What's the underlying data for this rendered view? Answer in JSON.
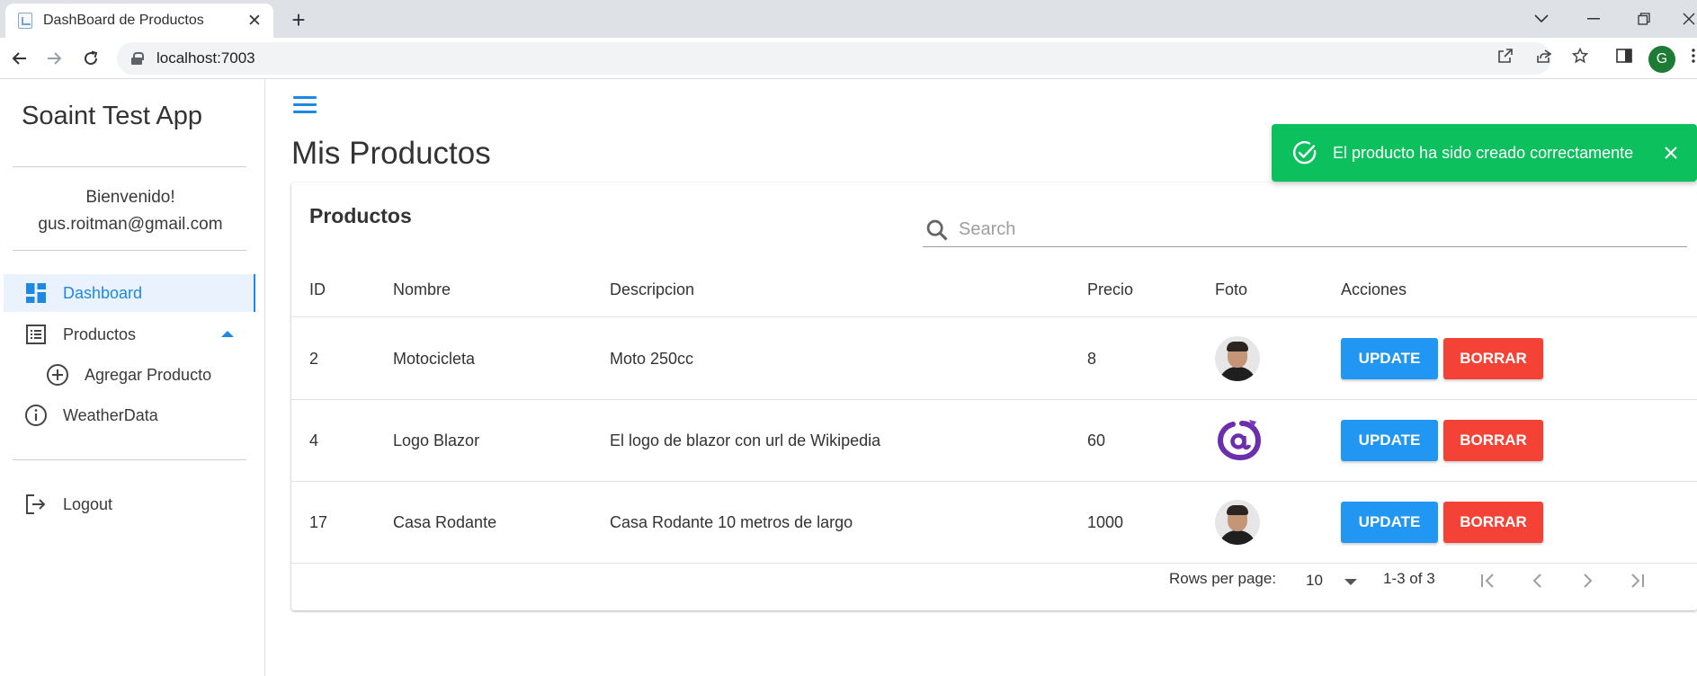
{
  "browser": {
    "tab_title": "DashBoard de Productos",
    "url": "localhost:7003",
    "profile_initial": "G"
  },
  "sidebar": {
    "app_title": "Soaint Test App",
    "welcome": "Bienvenido!",
    "user_email": "gus.roitman@gmail.com",
    "items": [
      {
        "label": "Dashboard",
        "icon": "dashboard-icon",
        "active": true
      },
      {
        "label": "Productos",
        "icon": "list-icon",
        "expanded": true
      },
      {
        "label": "Agregar Producto",
        "icon": "add-circle-icon"
      },
      {
        "label": "WeatherData",
        "icon": "info-icon"
      },
      {
        "label": "Logout",
        "icon": "logout-icon"
      }
    ]
  },
  "main": {
    "page_title": "Mis Productos",
    "card_title": "Productos",
    "search_placeholder": "Search",
    "columns": [
      "ID",
      "Nombre",
      "Descripcion",
      "Precio",
      "Foto",
      "Acciones"
    ],
    "rows": [
      {
        "id": "2",
        "nombre": "Motocicleta",
        "descripcion": "Moto 250cc",
        "precio": "8",
        "foto": "person-photo"
      },
      {
        "id": "4",
        "nombre": "Logo Blazor",
        "descripcion": "El logo de blazor con url de Wikipedia",
        "precio": "60",
        "foto": "blazor-logo"
      },
      {
        "id": "17",
        "nombre": "Casa Rodante",
        "descripcion": "Casa Rodante 10 metros de largo",
        "precio": "1000",
        "foto": "person-photo"
      }
    ],
    "actions": {
      "update": "UPDATE",
      "delete": "BORRAR"
    },
    "pager": {
      "rows_per_page_label": "Rows per page:",
      "rows_per_page": "10",
      "range": "1-3 of 3"
    }
  },
  "toast": {
    "message": "El producto ha sido creado correctamente",
    "color": "#0cc05e"
  },
  "colors": {
    "accent": "#1e88e5",
    "update_button": "#2196f3",
    "delete_button": "#f44336"
  }
}
